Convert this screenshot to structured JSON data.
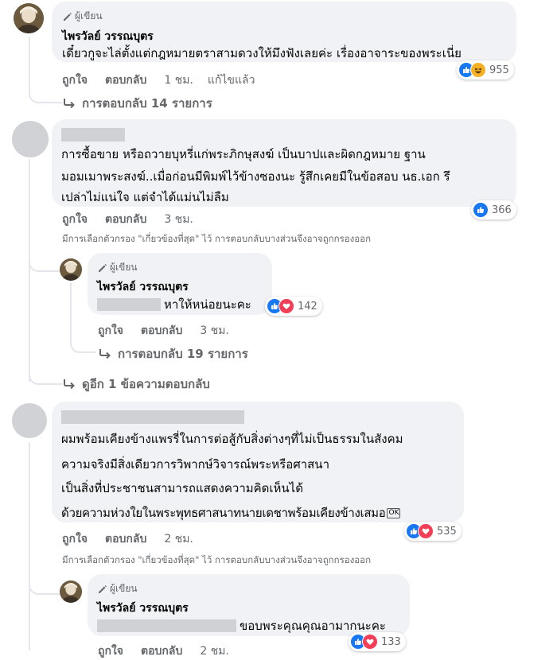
{
  "author_badge": "ผู้เขียน",
  "icons": {
    "author": "pencil-icon",
    "reply_arrow": "reply-arrow-icon",
    "like": "like-icon",
    "love": "love-icon",
    "haha": "haha-icon"
  },
  "colors": {
    "like": "#1877f2",
    "love": "#f33e58",
    "haha": "#f7b125",
    "bubble": "#f0f2f5",
    "meta": "#65676b"
  },
  "comments": [
    {
      "name": "ไพรวัลย์ วรรณบุตร",
      "text": "เดี๋ยวกูจะไล่ตั้งแต่กฎหมายตราสามดวงให้มึงฟังเลยค่ะ เรื่องอาจาระของพระเนี่ย",
      "like": "ถูกใจ",
      "reply": "ตอบกลับ",
      "time": "1 ชม.",
      "edited": "แก้ไขแล้ว",
      "reactions": "955",
      "replies": "การตอบกลับ 14 รายการ"
    },
    {
      "lines": [
        "การซื้อขาย หรือถวายบุหรี่แก่พระภิกษุสงฆ์ เป็นบาปและผิดกฎหมาย ฐาน",
        "มอมเมาพระสงฆ์..เมื่อก่อนมีพิมพ์ไว้ข้างซองนะ รู้สึกเคยมีในข้อสอบ นธ.เอก รึ",
        "เปล่าไม่แน่ใจ แต่จำได้แม่นไม่ลืม"
      ],
      "like": "ถูกใจ",
      "reply": "ตอบกลับ",
      "time": "3 ชม.",
      "reactions": "366",
      "filter_note": "มีการเลือกตัวกรอง \"เกี่ยวข้องที่สุด\" ไว้ การตอบกลับบางส่วนจึงอาจถูกกรองออก",
      "sub_reply": {
        "name": "ไพรวัลย์ วรรณบุตร",
        "text": "หาให้หน่อยนะคะ",
        "like": "ถูกใจ",
        "reply": "ตอบกลับ",
        "time": "3 ชม.",
        "reactions": "142",
        "replies": "การตอบกลับ 19 รายการ"
      },
      "more_replies": "ดูอีก 1 ข้อความตอบกลับ"
    },
    {
      "lines": [
        "ผมพร้อมเคียงข้างแพรรี่ในการต่อสู้กับสิ่งต่างๆที่ไม่เป็นธรรมในสังคม",
        "ความจริงมีสิ่งเดียวการวิพากษ์วิจารณ์พระหรือศาสนา",
        "เป็นสิ่งที่ประชาชนสามารถแสดงความคิดเห็นได้",
        "ด้วยความห่วงใยในพระพุทธศาสนาทนายเดชาพร้อมเคียงข้างเสมอ"
      ],
      "ok_sticker": "OK",
      "like": "ถูกใจ",
      "reply": "ตอบกลับ",
      "time": "2 ชม.",
      "reactions": "535",
      "filter_note": "มีการเลือกตัวกรอง \"เกี่ยวข้องที่สุด\" ไว้ การตอบกลับบางส่วนจึงอาจถูกกรองออก",
      "sub_reply": {
        "name": "ไพรวัลย์ วรรณบุตร",
        "text": "ขอบพระคุณคุณอามากนะคะ",
        "like": "ถูกใจ",
        "reply": "ตอบกลับ",
        "time": "2 ชม.",
        "reactions": "133"
      }
    }
  ]
}
